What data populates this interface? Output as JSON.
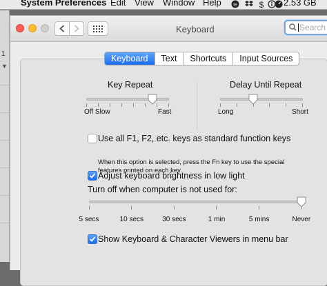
{
  "menubar": {
    "app_name": "System Preferences",
    "items": [
      "Edit",
      "View",
      "Window",
      "Help"
    ],
    "status": "2.53 GB",
    "icons": [
      "te-icon",
      "dropbox-icon",
      "dollar-icon",
      "info-icon",
      "speedometer-icon"
    ]
  },
  "sidebar_fragments": [
    "1",
    "▼"
  ],
  "window": {
    "title": "Keyboard",
    "search_placeholder": "Search"
  },
  "tabs": [
    "Keyboard",
    "Text",
    "Shortcuts",
    "Input Sources"
  ],
  "active_tab": 0,
  "key_repeat": {
    "label": "Key Repeat",
    "min_label": "Off Slow",
    "max_label": "Fast",
    "level": 0.8
  },
  "delay_until_repeat": {
    "label": "Delay Until Repeat",
    "min_label": "Long",
    "max_label": "Short",
    "level": 0.4
  },
  "function_keys": {
    "label": "Use all F1, F2, etc. keys as standard function keys",
    "note_line1": "When this option is selected, press the Fn key to use the special",
    "note_line2": "features printed on each key.",
    "checked": false
  },
  "brightness": {
    "label": "Adjust keyboard brightness in low light",
    "checked": true
  },
  "turn_off": {
    "label": "Turn off when computer is not used for:",
    "ticks": [
      "5 secs",
      "10 secs",
      "30 secs",
      "1 min",
      "5 mins",
      "Never"
    ],
    "selected": "Never"
  },
  "viewers": {
    "label": "Show Keyboard & Character Viewers in menu bar",
    "checked": true
  },
  "colors": {
    "accent": "#1c6ef2",
    "close": "#ff5f57",
    "minimize": "#febc2e"
  }
}
